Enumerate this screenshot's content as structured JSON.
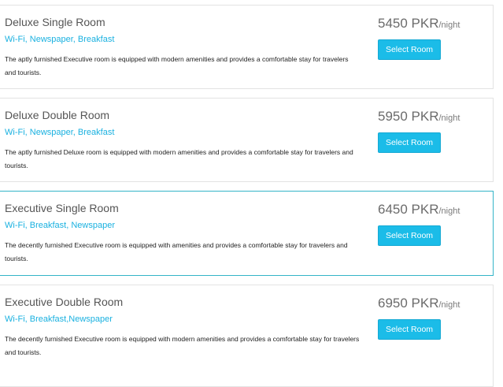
{
  "rooms": [
    {
      "name": "Deluxe Single Room",
      "amenities": "Wi-Fi, Newspaper, Breakfast",
      "description": "The aptly furnished Executive room is equipped with modern amenities and provides a comfortable stay for travelers and tourists.",
      "price": "5450 PKR",
      "unit": "/night",
      "button_label": "Select Room"
    },
    {
      "name": "Deluxe Double Room",
      "amenities": "Wi-Fi, Newspaper, Breakfast",
      "description": "The aptly furnished Deluxe room is equipped with modern amenities and provides a comfortable stay for travelers and tourists.",
      "price": "5950 PKR",
      "unit": "/night",
      "button_label": "Select Room"
    },
    {
      "name": "Executive Single Room",
      "amenities": "Wi-Fi, Breakfast, Newspaper",
      "description": "The decently furnished Executive room is equipped with amenities and provides a comfortable stay for travelers and tourists.",
      "price": "6450 PKR",
      "unit": "/night",
      "button_label": "Select Room"
    },
    {
      "name": "Executive Double Room",
      "amenities": "Wi-Fi, Breakfast,Newspaper",
      "description": "The decently furnished Executive room is equipped with modern amenities and provides a comfortable stay for travelers and tourists.",
      "price": "6950 PKR",
      "unit": "/night",
      "button_label": "Select Room"
    }
  ],
  "colors": {
    "accent": "#1bbce8",
    "amenities_text": "#1ab1e0",
    "highlight_border": "#34b4c8",
    "card_border": "#e3e3e3"
  }
}
